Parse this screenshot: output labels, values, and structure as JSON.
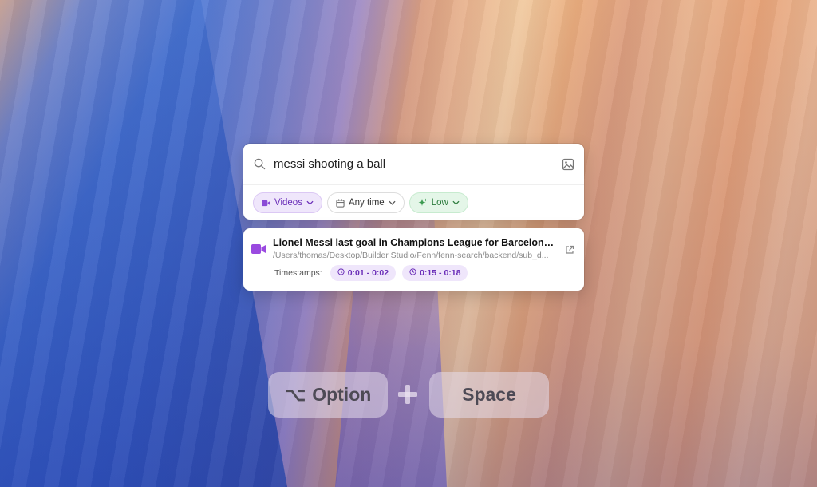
{
  "search": {
    "query": "messi shooting a ball"
  },
  "filters": [
    {
      "label": "Videos"
    },
    {
      "label": "Any time"
    },
    {
      "label": "Low"
    }
  ],
  "result": {
    "title": "Lionel Messi last goal in Champions League for Barcelona vs P...",
    "path": "/Users/thomas/Desktop/Builder Studio/Fenn/fenn-search/backend/sub_d...",
    "timestamps_label": "Timestamps:",
    "timestamps": [
      "0:01 - 0:02",
      "0:15 - 0:18"
    ]
  },
  "shortcut": {
    "modifier_symbol": "⌥",
    "modifier_label": "Option",
    "plus": "+",
    "key_label": "Space"
  },
  "colors": {
    "accent_purple": "#6b2fb8",
    "chip_purple_bg": "#efe6fb",
    "chip_green_bg": "#e4f6e8",
    "chip_green_text": "#2d7c3e"
  }
}
